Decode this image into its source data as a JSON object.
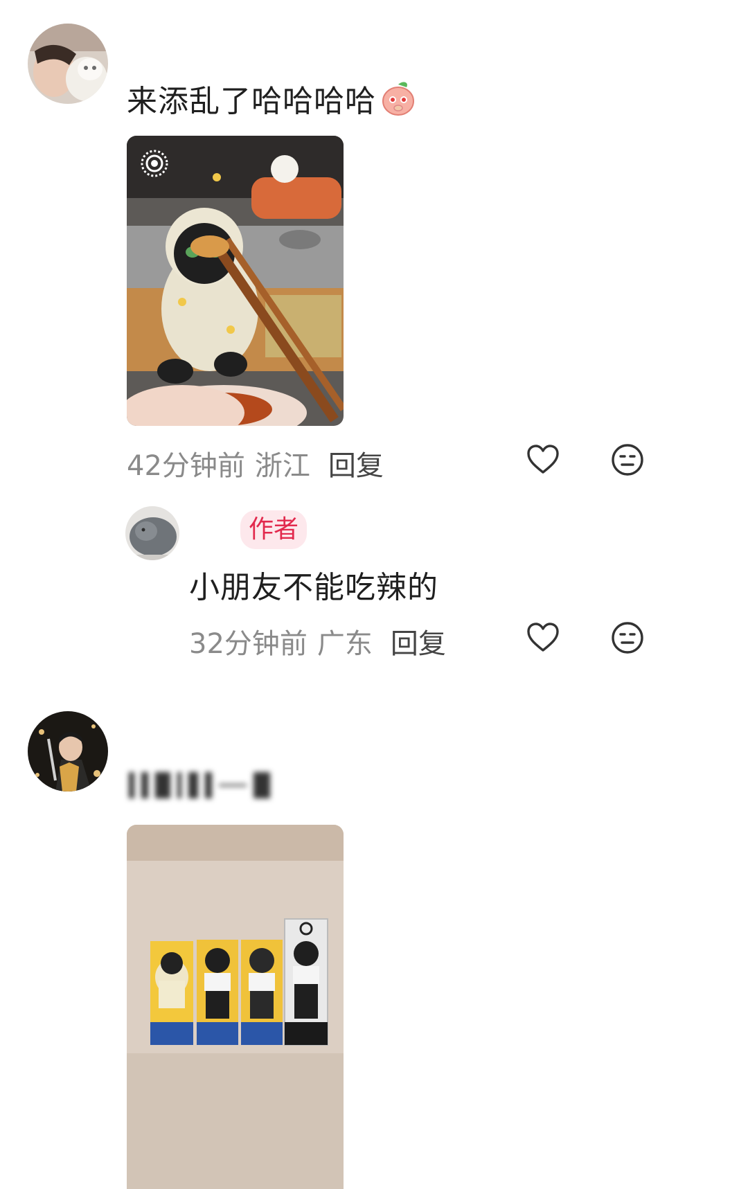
{
  "comments": [
    {
      "text": "来添乱了哈哈哈哈",
      "emoji_icon": "blushing-peach-emoji",
      "time": "42分钟前",
      "location": "浙江",
      "reply_label": "回复",
      "like_icon": "heart-outline-icon",
      "dislike_icon": "meh-face-icon",
      "replies": [
        {
          "badge": "作者",
          "text": "小朋友不能吃辣的",
          "time": "32分钟前",
          "location": "广东",
          "reply_label": "回复"
        }
      ]
    },
    {
      "text": ""
    }
  ],
  "colors": {
    "author_badge_bg": "#fde8ec",
    "author_badge_text": "#e2294d",
    "meta_gray": "#8a8a8a"
  }
}
